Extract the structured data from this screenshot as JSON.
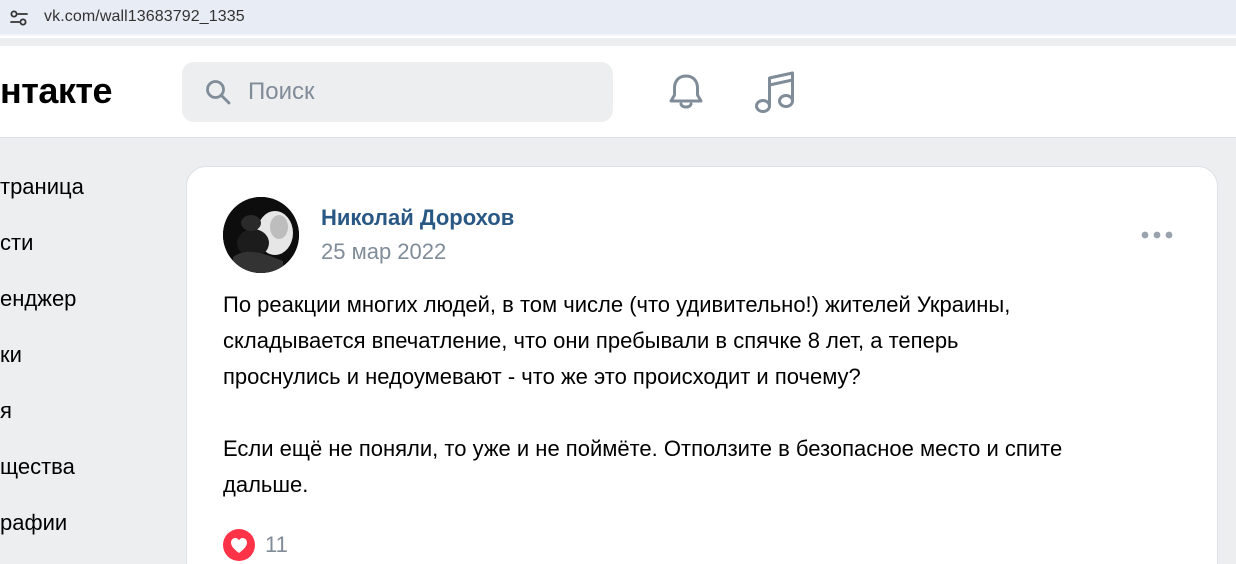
{
  "browser": {
    "url": "vk.com/wall13683792_1335",
    "site_info_icon": "tune-icon"
  },
  "header": {
    "logo_text": "нтакте",
    "search_placeholder": "Поиск",
    "icons": [
      "search-icon",
      "bell-icon",
      "music-note-icon"
    ]
  },
  "sidebar": {
    "items": [
      {
        "label": "траница"
      },
      {
        "label": "сти"
      },
      {
        "label": "енджер"
      },
      {
        "label": "ки"
      },
      {
        "label": "я"
      },
      {
        "label": "щества"
      },
      {
        "label": "рафии"
      }
    ]
  },
  "post": {
    "author": "Николай Дорохов",
    "date": "25 мар 2022",
    "text": "По реакции многих людей, в том числе (что удивительно!) жителей Украины,\nскладывается впечатление, что они пребывали в спячке 8 лет, а теперь\nпроснулись и недоумевают - что же это происходит и почему?\n\nЕсли ещё не поняли, то уже и не поймёте. Отползите в безопасное место и спите\nдальше.",
    "likes": "11",
    "icons": [
      "more-dots-icon",
      "heart-icon"
    ]
  },
  "colors": {
    "page_bg": "#edeef0",
    "link": "#2a5885",
    "muted": "#818c99",
    "like_red": "#ff3347",
    "address_bar": "#e8ecf5"
  }
}
